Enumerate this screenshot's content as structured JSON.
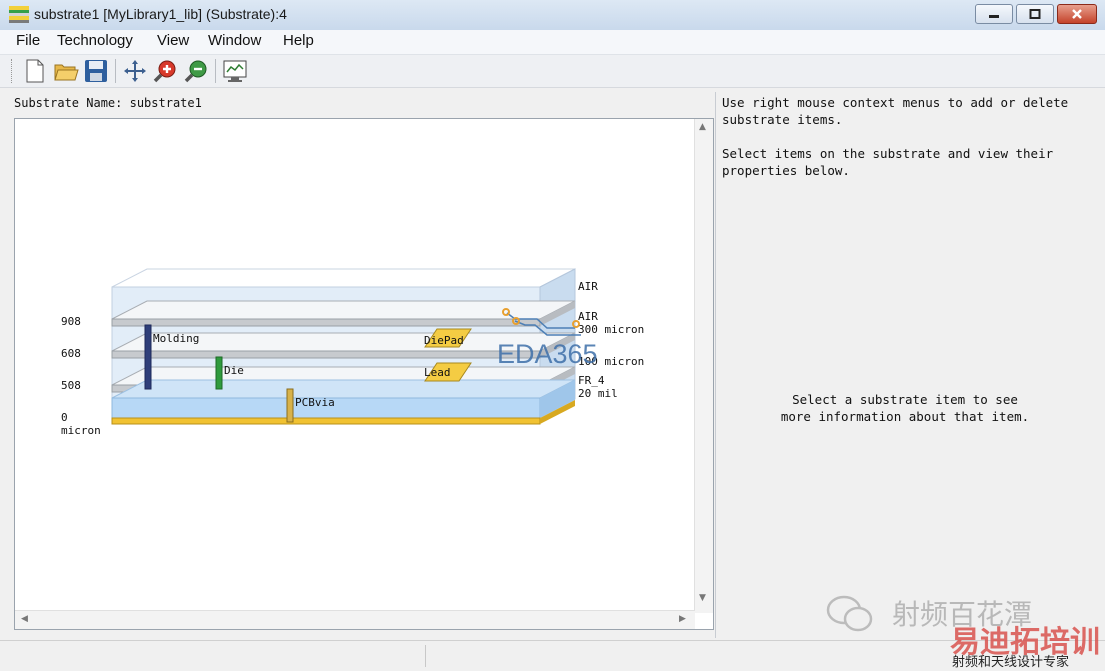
{
  "window": {
    "title": "substrate1 [MyLibrary1_lib] (Substrate):4"
  },
  "menu": [
    "File",
    "Technology",
    "View",
    "Window",
    "Help"
  ],
  "toolbar": [
    "new-icon",
    "open-icon",
    "save-icon",
    "pan-icon",
    "zoom-in-icon",
    "zoom-out-icon",
    "view-all-icon"
  ],
  "substrate": {
    "label": "Substrate Name:",
    "name": "substrate1"
  },
  "diagram": {
    "left_levels": [
      "908",
      "608",
      "508",
      "0",
      "micron"
    ],
    "right_labels": {
      "air_top": "AIR",
      "air_inner": "AIR",
      "thick1": "300 micron",
      "thick2": "100 micron",
      "fr4": "FR_4",
      "thick3": "20 mil"
    },
    "items": {
      "molding": "Molding",
      "die": "Die",
      "diepad": "DiePad",
      "lead": "Lead",
      "pcbvia": "PCBvia"
    },
    "logo": "EDA365"
  },
  "right_panel": {
    "help1": [
      "Use right mouse context menus to add or delete",
      "substrate items."
    ],
    "help2": [
      "Select items on the substrate and view their",
      "properties below."
    ],
    "info": [
      "Select a substrate item to see",
      "more information about that item."
    ]
  },
  "watermark": {
    "wechat": "射频百花潭",
    "brand": "易迪拓培训",
    "tagline": "射频和天线设计专家"
  }
}
